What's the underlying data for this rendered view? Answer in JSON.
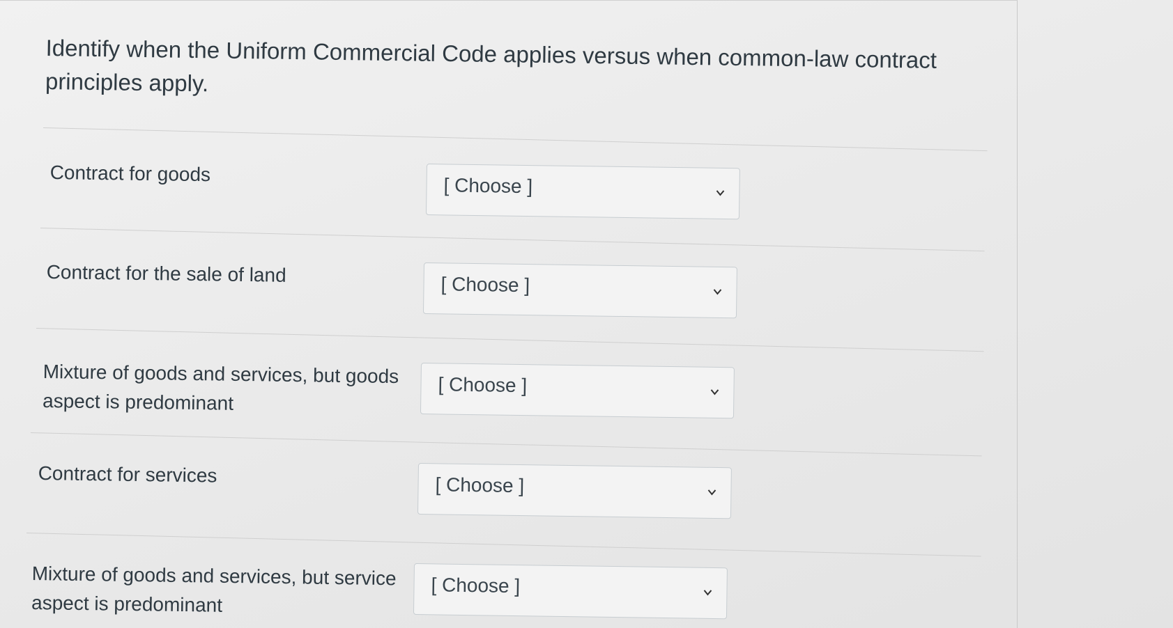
{
  "question": {
    "text": "Identify when the Uniform Commercial Code applies versus when common-law contract principles apply."
  },
  "rows": [
    {
      "label": "Contract for goods",
      "selected": "[ Choose ]"
    },
    {
      "label": "Contract for the sale of land",
      "selected": "[ Choose ]"
    },
    {
      "label": "Mixture of goods and services, but goods aspect is predominant",
      "selected": "[ Choose ]"
    },
    {
      "label": "Contract for services",
      "selected": "[ Choose ]"
    },
    {
      "label": "Mixture of goods and services, but service aspect is predominant",
      "selected": "[ Choose ]"
    }
  ],
  "icons": {
    "dropdown": "chevron-down-icon"
  }
}
